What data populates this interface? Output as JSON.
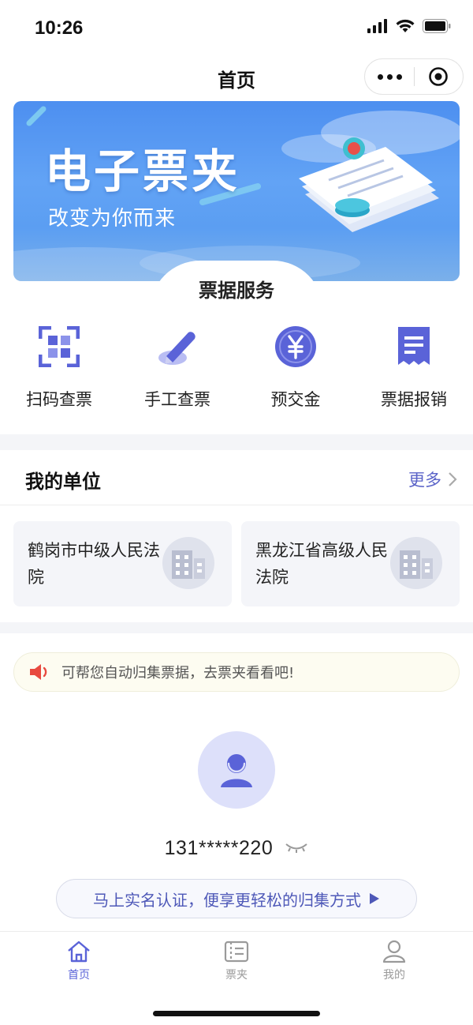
{
  "status_bar": {
    "time": "10:26"
  },
  "nav": {
    "title": "首页"
  },
  "banner": {
    "title": "电子票夹",
    "subtitle": "改变为你而来",
    "section_tab": "票据服务"
  },
  "services": [
    {
      "label": "扫码查票",
      "icon": "scan-qr-icon"
    },
    {
      "label": "手工查票",
      "icon": "pencil-icon"
    },
    {
      "label": "预交金",
      "icon": "yen-coin-icon"
    },
    {
      "label": "票据报销",
      "icon": "receipt-icon"
    }
  ],
  "units": {
    "title": "我的单位",
    "more": "更多",
    "items": [
      {
        "name": "鹤岗市中级人民法院"
      },
      {
        "name": "黑龙江省高级人民法院"
      }
    ]
  },
  "notice": {
    "text": "可帮您自动归集票据，去票夹看看吧!"
  },
  "profile": {
    "phone": "131*****220",
    "verify_label": "马上实名认证，便享更轻松的归集方式"
  },
  "tabbar": [
    {
      "label": "首页",
      "active": true
    },
    {
      "label": "票夹",
      "active": false
    },
    {
      "label": "我的",
      "active": false
    }
  ],
  "colors": {
    "accent": "#5a63d8",
    "banner": "#5b9ef2",
    "inactive": "#9a9a9a"
  }
}
